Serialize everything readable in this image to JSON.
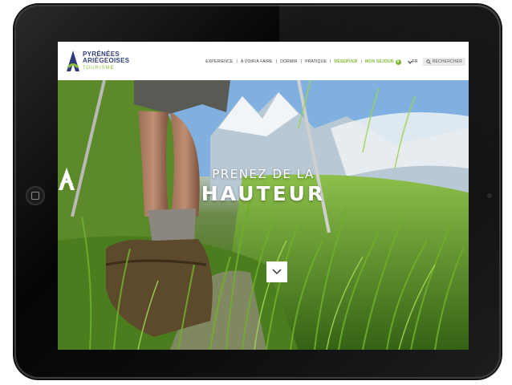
{
  "logo": {
    "line1": "PYRÉNÉES",
    "line2": "ARIÈGEOISES",
    "line3": "TOURISME"
  },
  "nav": {
    "items": [
      "EXPERIENCE",
      "A VOIR/A FAIRE",
      "DORMIR",
      "PRATIQUE",
      "RÉSERVER",
      "MON SÉJOUR"
    ],
    "badge": "0",
    "lang": "FR",
    "search_label": "RECHERCHER"
  },
  "hero": {
    "subtitle": "PRENEZ DE LA",
    "title": "HAUTEUR"
  },
  "colors": {
    "brand_green": "#7cb82f",
    "brand_navy": "#2f3b7a"
  }
}
